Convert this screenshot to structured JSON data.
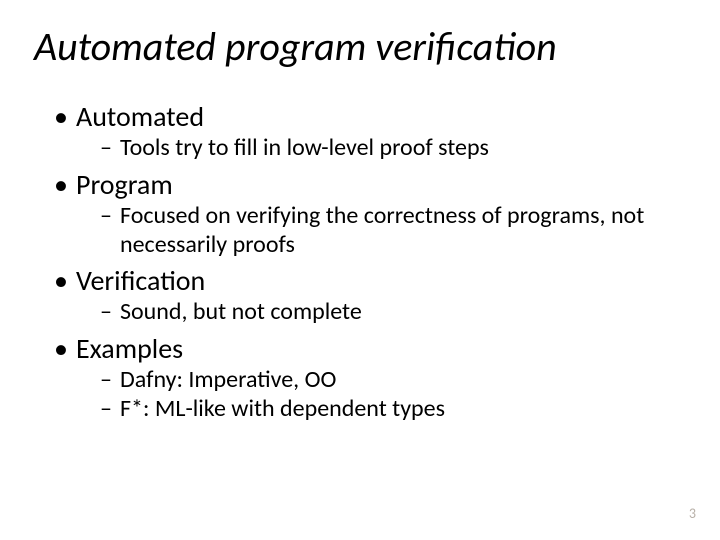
{
  "title": "Automated program verification",
  "items": [
    {
      "label": "Automated",
      "sub": [
        "Tools try to fill in low-level proof steps"
      ]
    },
    {
      "label": "Program",
      "sub": [
        "Focused on verifying the correctness of programs, not necessarily proofs"
      ]
    },
    {
      "label": "Verification",
      "sub": [
        "Sound, but not complete"
      ]
    },
    {
      "label": "Examples",
      "sub": [
        "Dafny: Imperative, OO",
        "F*: ML-like with dependent types"
      ]
    }
  ],
  "page_number": "3"
}
